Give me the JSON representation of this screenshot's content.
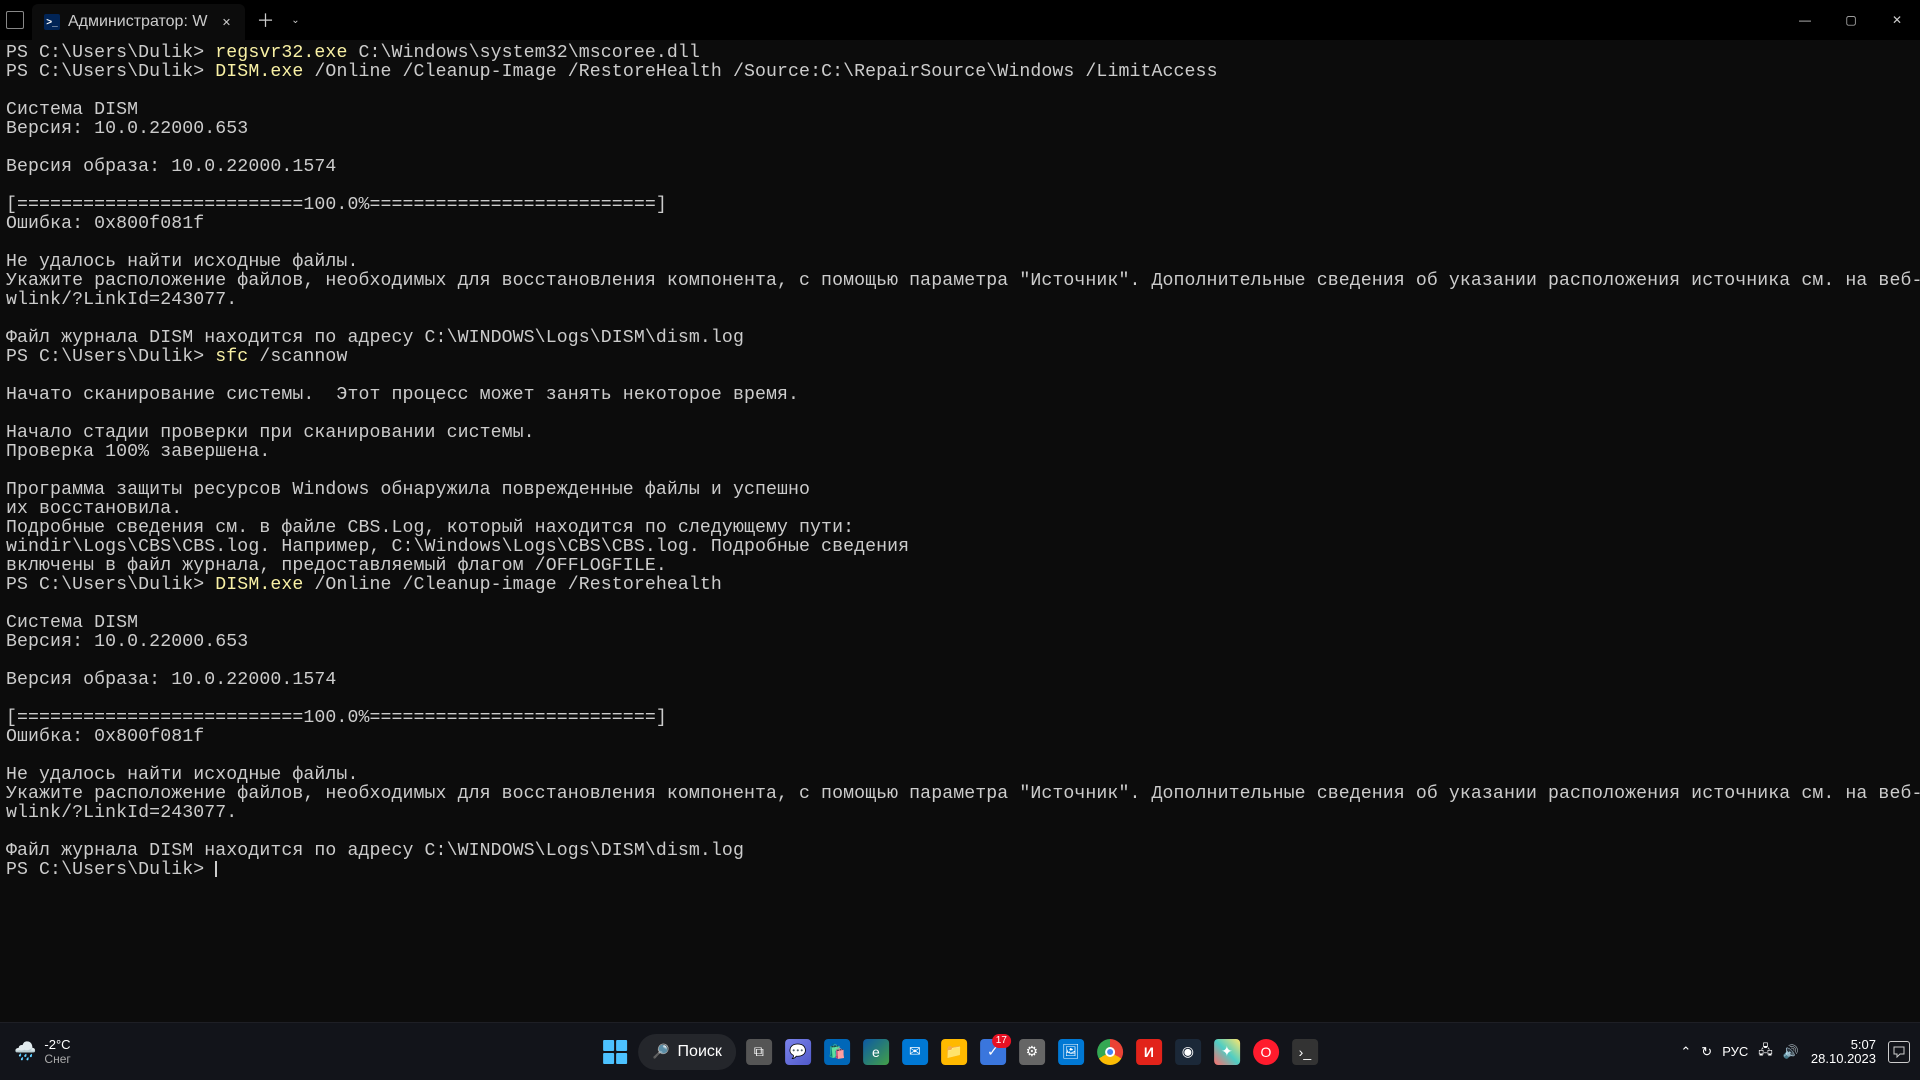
{
  "titlebar": {
    "tab_title": "Администратор: W",
    "ps_label": ">_"
  },
  "terminal": {
    "prompt": "PS C:\\Users\\Dulik>",
    "cmd1": "regsvr32.exe",
    "args1": " C:\\Windows\\system32\\mscoree.dll",
    "cmd2": "DISM.exe",
    "args2": " /Online /Cleanup-Image /RestoreHealth /Source:C:\\RepairSource\\Windows /LimitAccess",
    "dism_hdr": "Cистема DISM",
    "dism_ver": "Версия: 10.0.22000.653",
    "img_ver": "Версия образа: 10.0.22000.1574",
    "progress": "[==========================100.0%==========================]",
    "error": "Ошибка: 0x800f081f",
    "err1": "Не удалось найти исходные файлы.",
    "err2": "Укажите расположение файлов, необходимых для восстановления компонента, с помощью параметра \"Источник\". Дополнительные сведения об указании расположения источника см. на веб-странице https://go.microsoft.com/f",
    "err3": "wlink/?LinkId=243077.",
    "log": "Файл журнала DISM находится по адресу C:\\WINDOWS\\Logs\\DISM\\dism.log",
    "cmd3": "sfc",
    "args3": " /scannow",
    "sfc1": "Начато сканирование системы.  Этот процесс может занять некоторое время.",
    "sfc2": "Начало стадии проверки при сканировании системы.",
    "sfc3": "Проверка 100% завершена.",
    "sfc4": "Программа защиты ресурсов Windows обнаружила поврежденные файлы и успешно",
    "sfc5": "их восстановила.",
    "sfc6": "Подробные сведения см. в файле CBS.Log, который находится по следующему пути:",
    "sfc7": "windir\\Logs\\CBS\\CBS.log. Например, C:\\Windows\\Logs\\CBS\\CBS.log. Подробные сведения",
    "sfc8": "включены в файл журнала, предоставляемый флагом /OFFLOGFILE.",
    "cmd4": "DISM.exe",
    "args4": " /Online /Cleanup-image /Restorehealth"
  },
  "taskbar": {
    "weather_temp": "-2°C",
    "weather_label": "Снег",
    "search_label": "Поиск",
    "badge": "17",
    "lang": "РУС",
    "time": "5:07",
    "date": "28.10.2023"
  },
  "colors": {
    "accent": "#4cc2ff",
    "cmd": "#f9f1a5"
  }
}
